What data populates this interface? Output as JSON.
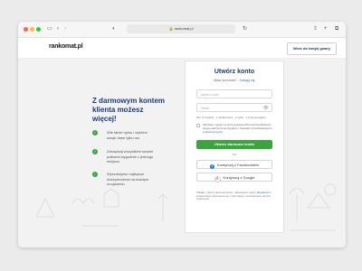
{
  "browser": {
    "url": "rankomat.pl"
  },
  "site": {
    "logo": "rankomat.pl",
    "panel_button": "Wróć do twojej gwary"
  },
  "hero": {
    "headline": "Z darmowym kontem klienta możesz więcej!",
    "features": [
      "Wie także opisu i wybierz swoje dane tylko raz",
      "Zarządzaj wszystkimi swoimi polisami wygodnie z jednego miejsca",
      "Wyszukujesz najlepsze ubezpieczenia na każdym urządzeniu"
    ]
  },
  "form": {
    "title": "Utwórz konto",
    "have_account": "Masz już konto?",
    "login_link": "Zaloguj się",
    "email_placeholder": "Adres e-mail",
    "password_placeholder": "Hasło",
    "password_hint": "Min. 8 znaków · 1 wielka litera · 1 cyfra · 1 znak specjalny",
    "consent_text": "Wyrażam zgodę na otrzymywanie informacji handlowych drogą elektroniczną zgodnie z zasadami przedstawionymi w",
    "consent_link": "klauzuli zgody",
    "submit": "Utwórz darmowe konto",
    "or": "lub",
    "facebook": "Kontynuuj z Facebookiem",
    "google": "Kontynuuj z Google",
    "footer_note": "Klikając „Utwórz darmowe konto”, akceptujesz zapisy",
    "footer_link": "Regulaminu",
    "footer_rest": "i potwierdzasz zapoznanie się z informacją o przetwarzaniu danych osobowych."
  },
  "colors": {
    "brand_blue": "#1d3a7a",
    "green": "#3aa53a",
    "link": "#2a6fd6"
  }
}
